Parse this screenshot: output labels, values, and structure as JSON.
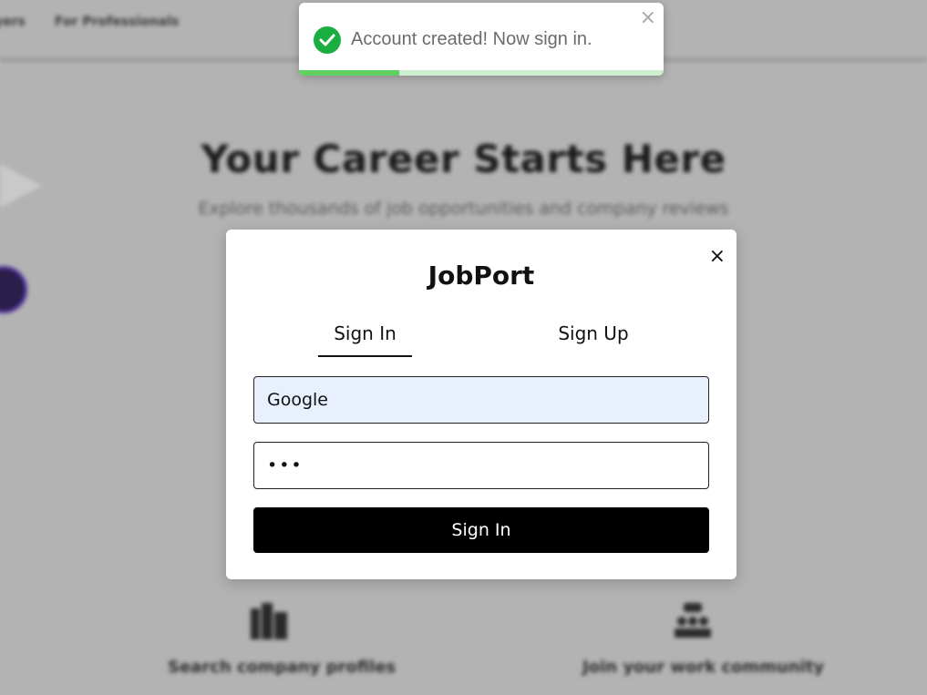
{
  "background": {
    "nav": {
      "link_1": "yers",
      "link_2": "For Professionals"
    },
    "hero": {
      "title": "Your Career Starts Here",
      "subtitle": "Explore thousands of job opportunities and company reviews"
    },
    "features": [
      {
        "label": "Search company profiles",
        "icon": "building-icon"
      },
      {
        "label": "Join your work community",
        "icon": "community-icon"
      }
    ]
  },
  "toast": {
    "message": "Account created! Now sign in.",
    "icon": "check-circle-icon",
    "close_label": "×",
    "progress": 0.275,
    "colors": {
      "check": "#1aad3f",
      "progress_fill": "#5fcf62",
      "progress_track": "#ccefd4"
    }
  },
  "modal": {
    "close_label": "×",
    "title": "JobPort",
    "tabs": [
      {
        "label": "Sign In",
        "active": true
      },
      {
        "label": "Sign Up",
        "active": false
      }
    ],
    "username_value": "Google",
    "password_value": "•••",
    "submit_label": "Sign In",
    "colors": {
      "autofill_bg": "#e8f0fe",
      "button_bg": "#000000"
    }
  }
}
